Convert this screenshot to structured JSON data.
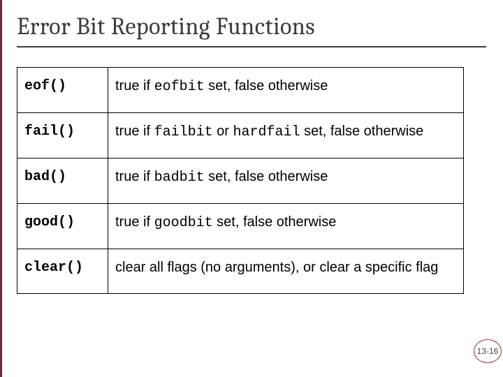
{
  "title": "Error Bit Reporting Functions",
  "rows": [
    {
      "fn": "eof()",
      "desc_parts": [
        "true if ",
        "eofbit",
        " set, false otherwise"
      ]
    },
    {
      "fn": "fail()",
      "desc_parts": [
        "true if ",
        "failbit",
        " or ",
        "hardfail",
        " set, false otherwise"
      ]
    },
    {
      "fn": "bad()",
      "desc_parts": [
        "true if ",
        "badbit",
        " set, false otherwise"
      ]
    },
    {
      "fn": "good()",
      "desc_parts": [
        "true if ",
        "goodbit",
        " set, false otherwise"
      ]
    },
    {
      "fn": "clear()",
      "desc_parts": [
        "clear all flags (no arguments), or clear a specific flag"
      ]
    }
  ],
  "page_number": "13-16"
}
